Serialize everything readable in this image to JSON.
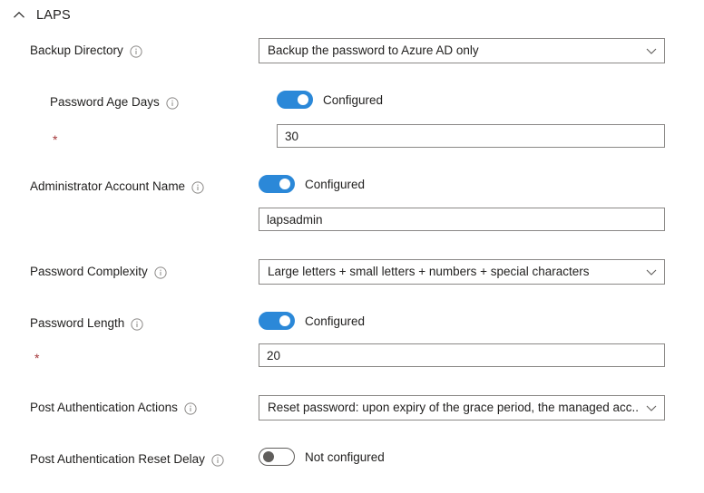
{
  "section": {
    "title": "LAPS",
    "collapse_icon": "chevron-up-icon",
    "expanded": true
  },
  "accent_color": "#2b88d8",
  "required_marker": "*",
  "required_marker_color": "#a4373a",
  "info_icon_name": "info-icon",
  "settings": [
    {
      "id": "backup-directory",
      "label": "Backup Directory",
      "control": "dropdown",
      "value": "Backup the password to Azure AD only",
      "required": false,
      "indented": false
    },
    {
      "id": "password-age-days",
      "label": "Password Age Days",
      "control": "toggle-with-text",
      "toggle_state": "on",
      "toggle_label": "Configured",
      "value": "30",
      "required": true,
      "indented": true
    },
    {
      "id": "administrator-account-name",
      "label": "Administrator Account Name",
      "control": "toggle-with-text",
      "toggle_state": "on",
      "toggle_label": "Configured",
      "value": "lapsadmin",
      "required": false,
      "indented": false
    },
    {
      "id": "password-complexity",
      "label": "Password Complexity",
      "control": "dropdown",
      "value": "Large letters + small letters + numbers + special characters",
      "required": false,
      "indented": false
    },
    {
      "id": "password-length",
      "label": "Password Length",
      "control": "toggle-with-text",
      "toggle_state": "on",
      "toggle_label": "Configured",
      "value": "20",
      "required": true,
      "indented": false
    },
    {
      "id": "post-authentication-actions",
      "label": "Post Authentication Actions",
      "control": "dropdown",
      "value": "Reset password: upon expiry of the grace period, the managed acc...",
      "required": false,
      "indented": false
    },
    {
      "id": "post-authentication-reset-delay",
      "label": "Post Authentication Reset Delay",
      "control": "toggle",
      "toggle_state": "off",
      "toggle_label": "Not configured",
      "required": false,
      "indented": false
    }
  ]
}
